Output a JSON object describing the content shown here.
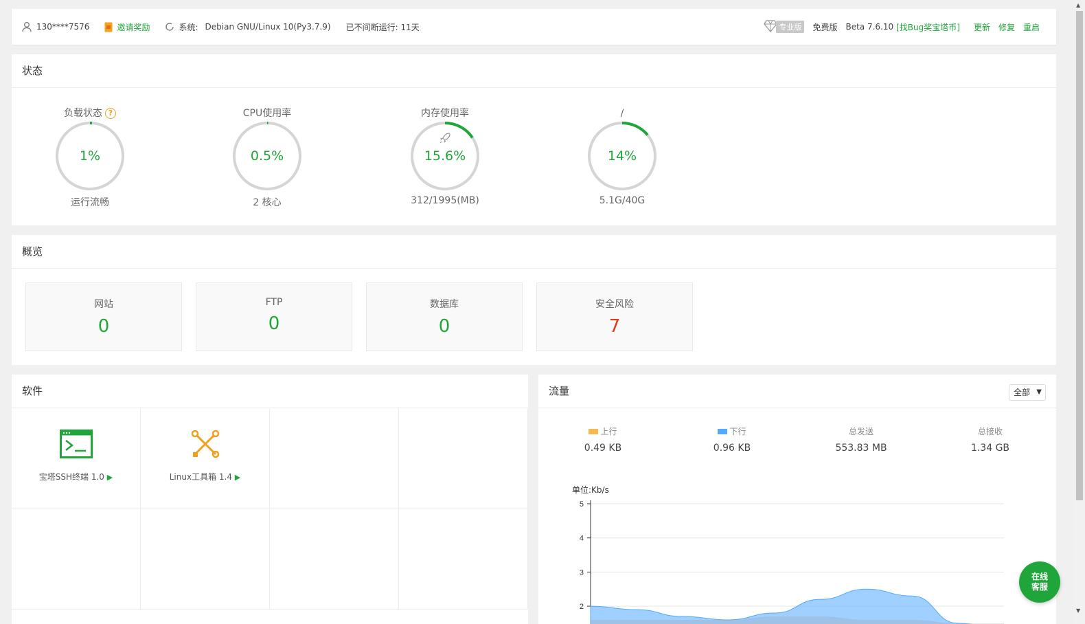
{
  "topbar": {
    "user": "130****7576",
    "invite": "邀请奖励",
    "system_label": "系统:",
    "system_value": "Debian GNU/Linux 10(Py3.7.9)",
    "uptime": "已不间断运行: 11天",
    "pro_badge": "专业版",
    "edition": "免费版",
    "version": "Beta 7.6.10",
    "bug_link": "[找Bug奖宝塔币]",
    "update": "更新",
    "repair": "修复",
    "restart": "重启"
  },
  "status": {
    "title": "状态",
    "gauges": [
      {
        "title": "负载状态",
        "value": "1%",
        "sub": "运行流畅",
        "percent": 1
      },
      {
        "title": "CPU使用率",
        "value": "0.5%",
        "sub": "2 核心",
        "percent": 0.5
      },
      {
        "title": "内存使用率",
        "value": "15.6%",
        "sub": "312/1995(MB)",
        "percent": 15.6
      },
      {
        "title": "/",
        "value": "14%",
        "sub": "5.1G/40G",
        "percent": 14
      }
    ]
  },
  "overview": {
    "title": "概览",
    "cards": [
      {
        "label": "网站",
        "value": "0"
      },
      {
        "label": "FTP",
        "value": "0"
      },
      {
        "label": "数据库",
        "value": "0"
      },
      {
        "label": "安全风险",
        "value": "7"
      }
    ]
  },
  "software": {
    "title": "软件",
    "items": [
      {
        "name": "宝塔SSH终端 1.0",
        "icon": "terminal-icon"
      },
      {
        "name": "Linux工具箱 1.4",
        "icon": "tools-icon"
      }
    ]
  },
  "traffic": {
    "title": "流量",
    "select_value": "全部",
    "stats": [
      {
        "label": "上行",
        "value": "0.49 KB",
        "color": "#f7b851"
      },
      {
        "label": "下行",
        "value": "0.96 KB",
        "color": "#52a9ff"
      },
      {
        "label": "总发送",
        "value": "553.83 MB"
      },
      {
        "label": "总接收",
        "value": "1.34 GB"
      }
    ],
    "unit": "单位:Kb/s"
  },
  "chart_data": {
    "type": "area",
    "ylabel": "单位:Kb/s",
    "ylim": [
      0,
      5
    ],
    "yticks": [
      "5",
      "4",
      "3",
      "2"
    ],
    "series": [
      {
        "name": "下行",
        "values": [
          2.0,
          1.9,
          1.7,
          1.6,
          1.8,
          2.2,
          2.5,
          2.3,
          1.5,
          1.3
        ]
      },
      {
        "name": "上行",
        "values": [
          1.6,
          1.6,
          1.6,
          1.6,
          1.7,
          1.7,
          1.6,
          1.6,
          1.5,
          1.5
        ]
      }
    ],
    "colors": {
      "up": "#f7b851",
      "down": "#52a9ff"
    }
  },
  "chat": {
    "line1": "在线",
    "line2": "客服"
  },
  "colors": {
    "accent": "#20a53a",
    "danger": "#e13b1a"
  }
}
